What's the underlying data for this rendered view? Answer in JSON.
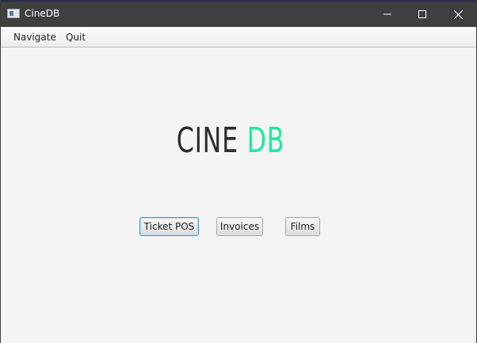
{
  "window": {
    "title": "CineDB",
    "controls": {
      "minimize": "minimize-icon",
      "maximize": "maximize-icon",
      "close": "close-icon"
    }
  },
  "menu": {
    "items": [
      {
        "label": "Navigate"
      },
      {
        "label": "Quit"
      }
    ]
  },
  "logo": {
    "part1": "CINE",
    "part2": "DB",
    "colors": {
      "part1": "#2b2b2b",
      "part2": "#1de9a0"
    }
  },
  "buttons": {
    "ticket_pos": "Ticket POS",
    "invoices": "Invoices",
    "films": "Films"
  }
}
